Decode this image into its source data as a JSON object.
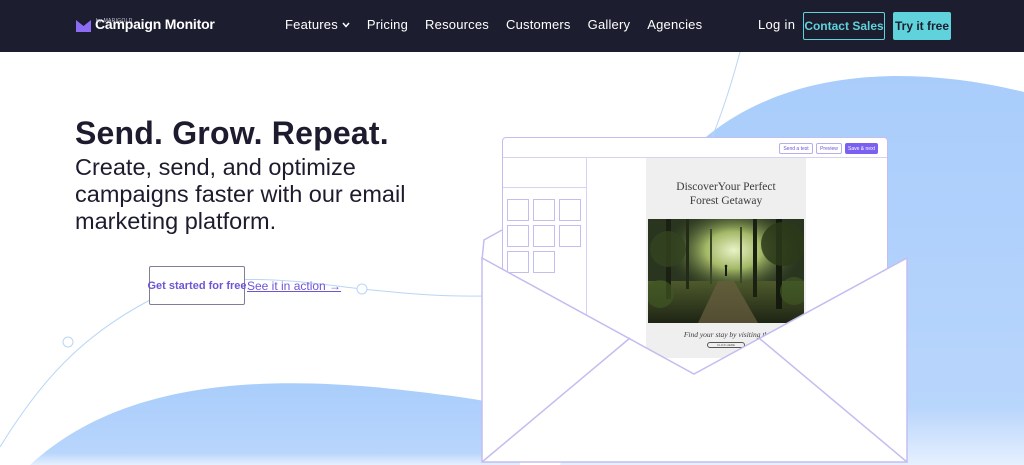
{
  "nav": {
    "brand": "Campaign Monitor",
    "brand_sub": "by MARIGOLD",
    "links": [
      {
        "label": "Features",
        "has_dropdown": true
      },
      {
        "label": "Pricing"
      },
      {
        "label": "Resources"
      },
      {
        "label": "Customers"
      },
      {
        "label": "Gallery"
      },
      {
        "label": "Agencies"
      }
    ],
    "login": "Log in",
    "contact_sales": "Contact Sales",
    "try_free": "Try it free"
  },
  "hero": {
    "title": "Send. Grow. Repeat.",
    "subtitle": "Create, send, and optimize campaigns faster with our email marketing platform.",
    "cta_primary": "Get started for free",
    "cta_secondary": "See it in action →"
  },
  "mockup": {
    "toolbar": {
      "send_test": "Send a test",
      "preview": "Preview",
      "save_next": "Save & next"
    },
    "email": {
      "headline_line1": "DiscoverYour Perfect",
      "headline_line2": "Forest Getaway",
      "caption": "Find your stay by visiting th",
      "cta": "CLICK HERE"
    }
  },
  "colors": {
    "nav_bg": "#1c1d2e",
    "accent_teal": "#5fd2dc",
    "accent_purple": "#6e55d4",
    "blob_blue": "#a8ccfb"
  }
}
